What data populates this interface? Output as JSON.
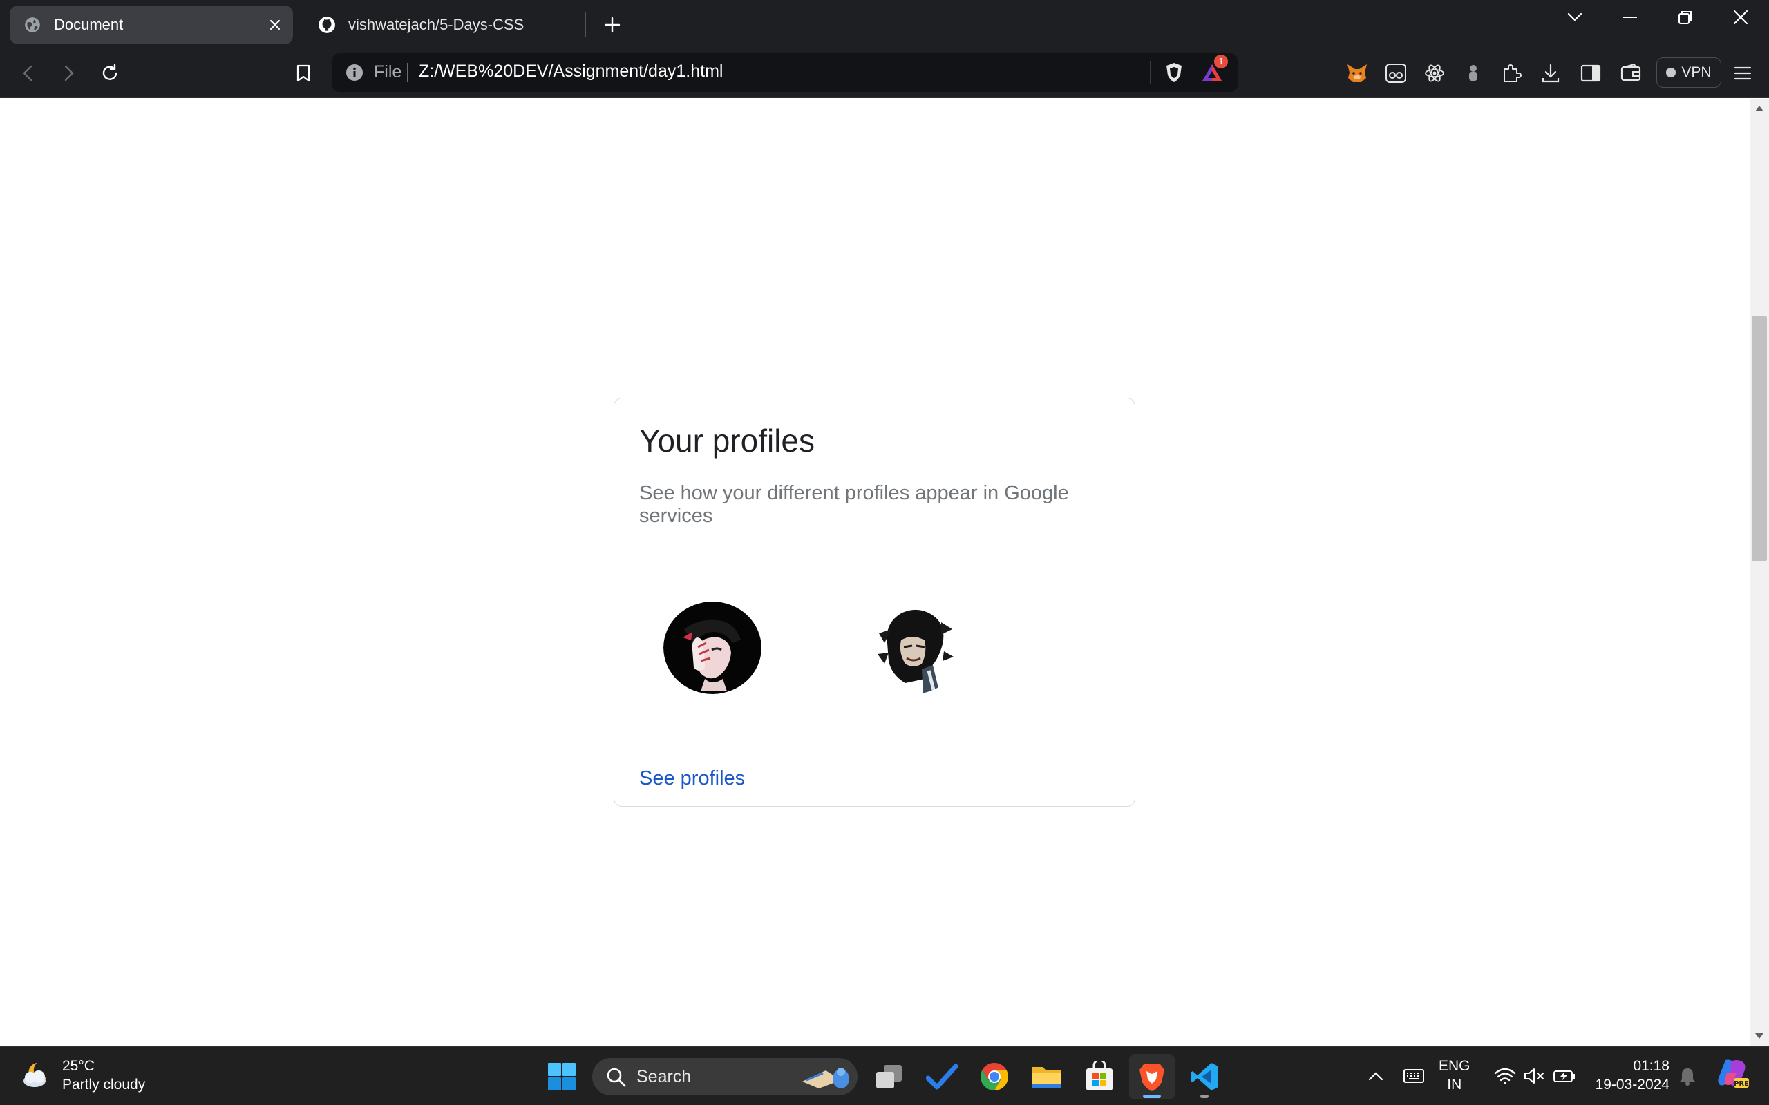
{
  "browser": {
    "tabs": [
      {
        "title": "Document",
        "active": true
      },
      {
        "title": "vishwatejach/5-Days-CSS",
        "active": false
      }
    ],
    "address_bar": {
      "scheme_label": "File",
      "url": "Z:/WEB%20DEV/Assignment/day1.html"
    },
    "shield_badge": "1",
    "vpn_label": "VPN"
  },
  "card": {
    "title": "Your profiles",
    "subtitle": "See how your different profiles appear in Google services",
    "link": "See profiles"
  },
  "taskbar": {
    "weather": {
      "temp": "25°C",
      "condition": "Partly cloudy"
    },
    "search_label": "Search",
    "language": {
      "line1": "ENG",
      "line2": "IN"
    },
    "clock": {
      "time": "01:18",
      "date": "19-03-2024"
    }
  },
  "colors": {
    "browser_chrome": "#1e1f23",
    "link_blue": "#1a57c9",
    "taskbar": "#202020"
  }
}
